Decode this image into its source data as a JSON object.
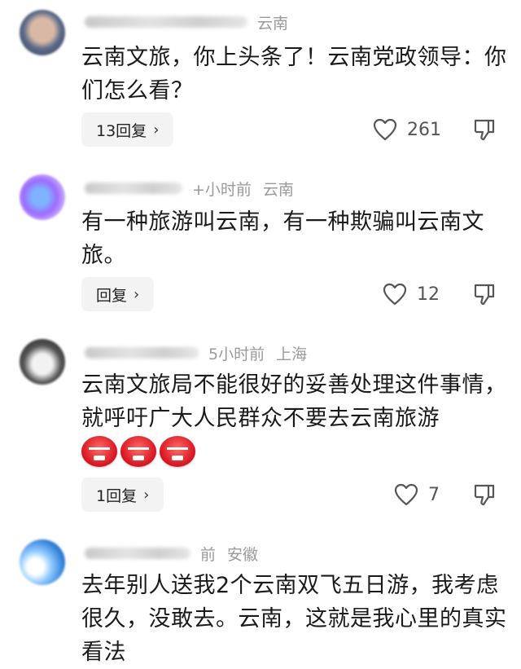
{
  "comments": [
    {
      "location": "云南",
      "time": "",
      "text": "云南文旅，你上头条了！云南党政领导：你们怎么看？",
      "reply_label": "13回复",
      "likes": "261"
    },
    {
      "location": "云南",
      "time": "+小时前",
      "text": "有一种旅游叫云南，有一种欺骗叫云南文旅。",
      "reply_label": "回复",
      "likes": "12"
    },
    {
      "location": "上海",
      "time": "5小时前",
      "text": "云南文旅局不能很好的妥善处理这件事情，就呼吁广大人民群众不要去云南旅游",
      "reply_label": "1回复",
      "likes": "7",
      "emojis": [
        "angry-face-icon",
        "angry-face-icon",
        "angry-face-icon"
      ]
    },
    {
      "location": "安徽",
      "time": "前",
      "text": "去年别人送我2个云南双飞五日游，我考虑很久，没敢去。云南，这就是我心里的真实看法"
    }
  ],
  "icons": {
    "reply_chevron": "›",
    "like": "heart-outline-icon",
    "dislike": "thumbs-down-icon"
  },
  "colors": {
    "meta_text": "#9a9a9a",
    "reply_bg": "#f3f3f3",
    "emoji_red": "#d7121d"
  }
}
